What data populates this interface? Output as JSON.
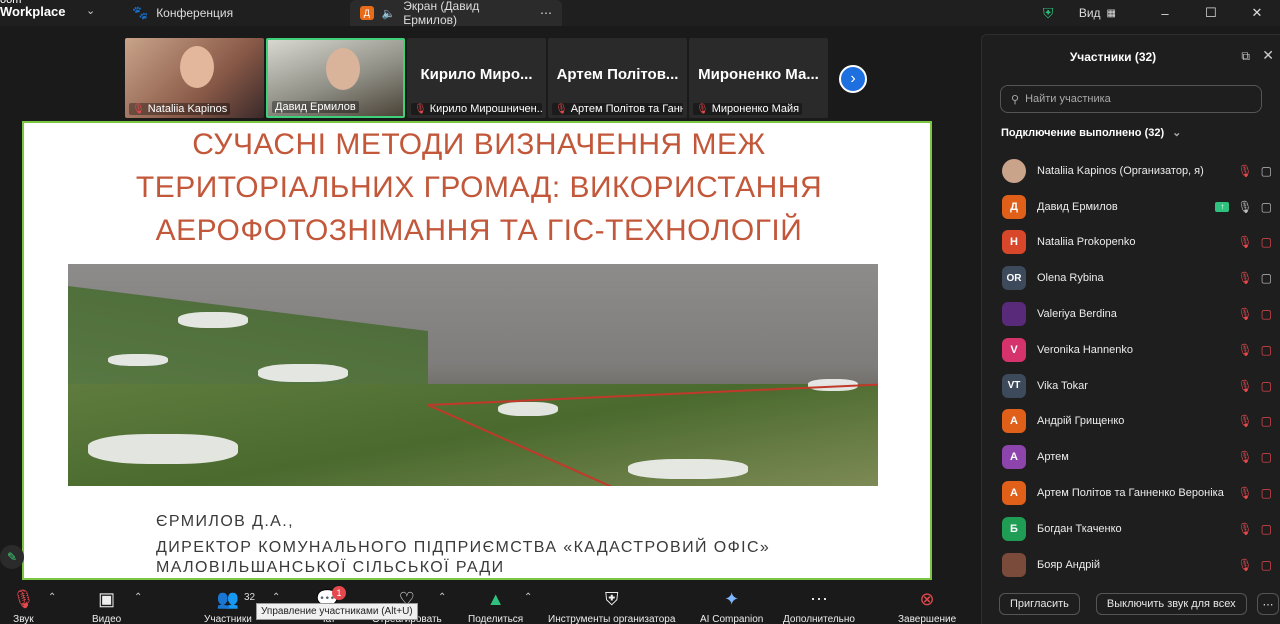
{
  "titlebar": {
    "brand_line1": "oom",
    "brand_line2": "Workplace",
    "tab_conference": "Конференция",
    "tab_screen_letter": "Д",
    "tab_screen": "Экран (Давид Ермилов)",
    "view_label": "Вид"
  },
  "thumbnails": [
    {
      "name": "Nataliia Kapinos"
    },
    {
      "name": "Давид Ермилов"
    },
    {
      "big": "Кирило Миро...",
      "name": "Кирило Мирошничен..."
    },
    {
      "big": "Артем Політов...",
      "name": "Артем Політов та Ганн..."
    },
    {
      "big": "Мироненко Ма...",
      "name": "Мироненко Майя"
    }
  ],
  "slide": {
    "title_lines": [
      "СУЧАСНІ МЕТОДИ ВИЗНАЧЕННЯ МЕЖ",
      "ТЕРИТОРІАЛЬНИХ ГРОМАД: ВИКОРИСТАННЯ",
      "АЕРОФОТОЗНІМАННЯ ТА ГІС-ТЕХНОЛОГІЙ"
    ],
    "author_name": "ЄРМИЛОВ Д.А.,",
    "author_line1": "ДИРЕКТОР КОМУНАЛЬНОГО ПІДПРИЄМСТВА «КАДАСТРОВИЙ ОФІС»",
    "author_line2": "МАЛОВІЛЬШАНСЬКОЇ СІЛЬСЬКОЇ РАДИ"
  },
  "panel": {
    "title": "Участники (32)",
    "search_placeholder": "Найти участника",
    "group_label": "Подключение выполнено (32)",
    "participants": [
      {
        "name": "Nataliia Kapinos (Организатор, я)",
        "initials": "",
        "color": "#c9a38a"
      },
      {
        "name": "Давид Ермилов",
        "initials": "Д",
        "color": "#e0601a"
      },
      {
        "name": "Nataliia Prokopenko",
        "initials": "Н",
        "color": "#d9472b"
      },
      {
        "name": "Olena Rybina",
        "initials": "OR",
        "color": "#3d4a5c"
      },
      {
        "name": "Valeriya Berdina",
        "initials": "",
        "color": "#5a2a7a"
      },
      {
        "name": "Veronika Hannenko",
        "initials": "V",
        "color": "#d6336c"
      },
      {
        "name": "Vika Tokar",
        "initials": "VT",
        "color": "#3d4a5c"
      },
      {
        "name": "Андрій Грищенко",
        "initials": "А",
        "color": "#e0601a"
      },
      {
        "name": "Артем",
        "initials": "А",
        "color": "#8e44ad"
      },
      {
        "name": "Артем Політов та Ганненко Вероніка",
        "initials": "А",
        "color": "#e0601a"
      },
      {
        "name": "Богдан Ткаченко",
        "initials": "Б",
        "color": "#1f9d55"
      },
      {
        "name": "Бояр Андрій",
        "initials": "",
        "color": "#7a4a3a"
      }
    ],
    "invite_label": "Пригласить",
    "mute_all_label": "Выключить звук для всех"
  },
  "toolbar": {
    "audio_label": "Звук",
    "video_label": "Видео",
    "participants_label": "Участники",
    "participants_count": "32",
    "chat_label": "Чат",
    "chat_badge": "1",
    "react_label": "Отреагировать",
    "share_label": "Поделиться",
    "host_tools_label": "Инструменты организатора",
    "ai_label": "AI Companion",
    "more_label": "Дополнительно",
    "end_label": "Завершение",
    "tooltip": "Управление участниками (Alt+U)"
  },
  "colors": {
    "accent_blue": "#1e6fe0",
    "active_green": "#3fd17a",
    "muted_red": "#e5484d",
    "slide_title": "#c2573a"
  }
}
